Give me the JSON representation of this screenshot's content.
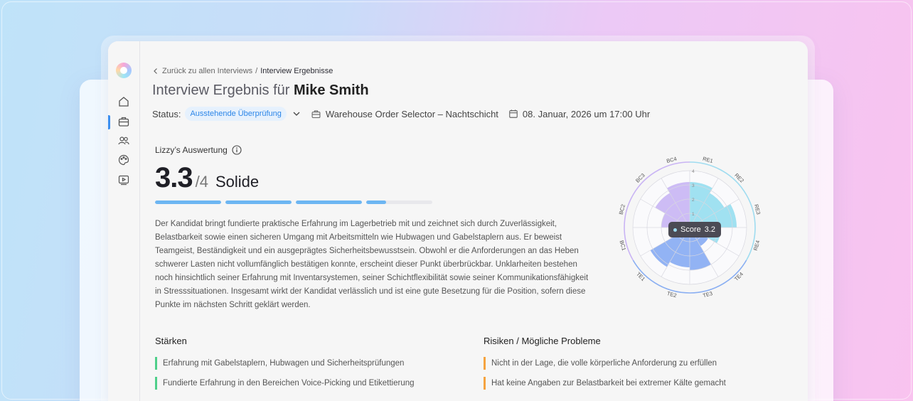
{
  "breadcrumb": {
    "back_label": "Zurück zu allen Interviews",
    "separator": "/",
    "current": "Interview Ergebnisse"
  },
  "header": {
    "title_prefix": "Interview Ergebnis für",
    "candidate_name": "Mike Smith"
  },
  "meta": {
    "status_label": "Status:",
    "status_value": "Ausstehende Überprüfung",
    "position": "Warehouse Order Selector – Nachtschicht",
    "datetime": "08. Januar, 2026 um 17:00 Uhr"
  },
  "evaluation": {
    "label": "Lizzy’s Auswertung",
    "score": "3.3",
    "score_max": "/4",
    "rating_word": "Solide",
    "progress_fraction": 0.825,
    "summary": "Der Kandidat bringt fundierte praktische Erfahrung im Lagerbetrieb mit und zeichnet sich durch Zuverlässigkeit, Belastbarkeit sowie einen sicheren Umgang mit Arbeitsmitteln wie Hubwagen und Gabelstaplern aus. Er beweist Teamgeist, Beständigkeit und ein ausgeprägtes Sicherheitsbewusstsein. Obwohl er die Anforderungen an das Heben schwerer Lasten nicht vollumfänglich bestätigen konnte, erscheint dieser Punkt überbrückbar. Unklarheiten bestehen noch hinsichtlich seiner Erfahrung mit Inventarsystemen, seiner Schichtflexibilität sowie seiner Kommunikationsfähigkeit in Stresssituationen. Insgesamt wirkt der Kandidat verlässlich und ist eine gute Besetzung für die Position, sofern diese Punkte im nächsten Schritt geklärt werden."
  },
  "radar": {
    "categories": [
      "RE1",
      "RE2",
      "RE3",
      "RE4",
      "TE4",
      "TE3",
      "TE2",
      "TE1",
      "BC1",
      "BC2",
      "BC3",
      "BC4"
    ],
    "values": [
      3.2,
      2.8,
      3.3,
      2.2,
      1.5,
      3.0,
      2.8,
      3.2,
      1.5,
      2.0,
      2.8,
      3.2
    ],
    "rings": [
      "1",
      "2",
      "3",
      "4"
    ],
    "max": 4,
    "colors": {
      "RE": "#8fdcee",
      "TE": "#7fa6f2",
      "BC": "#c4b0f3"
    },
    "tooltip_label": "Score",
    "tooltip_value": "3.2"
  },
  "strengths": {
    "title": "Stärken",
    "items": [
      "Erfahrung mit Gabelstaplern, Hubwagen und Sicherheitsprüfungen",
      "Fundierte Erfahrung in den Bereichen Voice-Picking und Etikettierung"
    ]
  },
  "risks": {
    "title": "Risiken / Mögliche Probleme",
    "items": [
      "Nicht in der Lage, die volle körperliche Anforderung zu erfüllen",
      "Hat keine Angaben zur Belastbarkeit bei extremer Kälte gemacht"
    ]
  }
}
